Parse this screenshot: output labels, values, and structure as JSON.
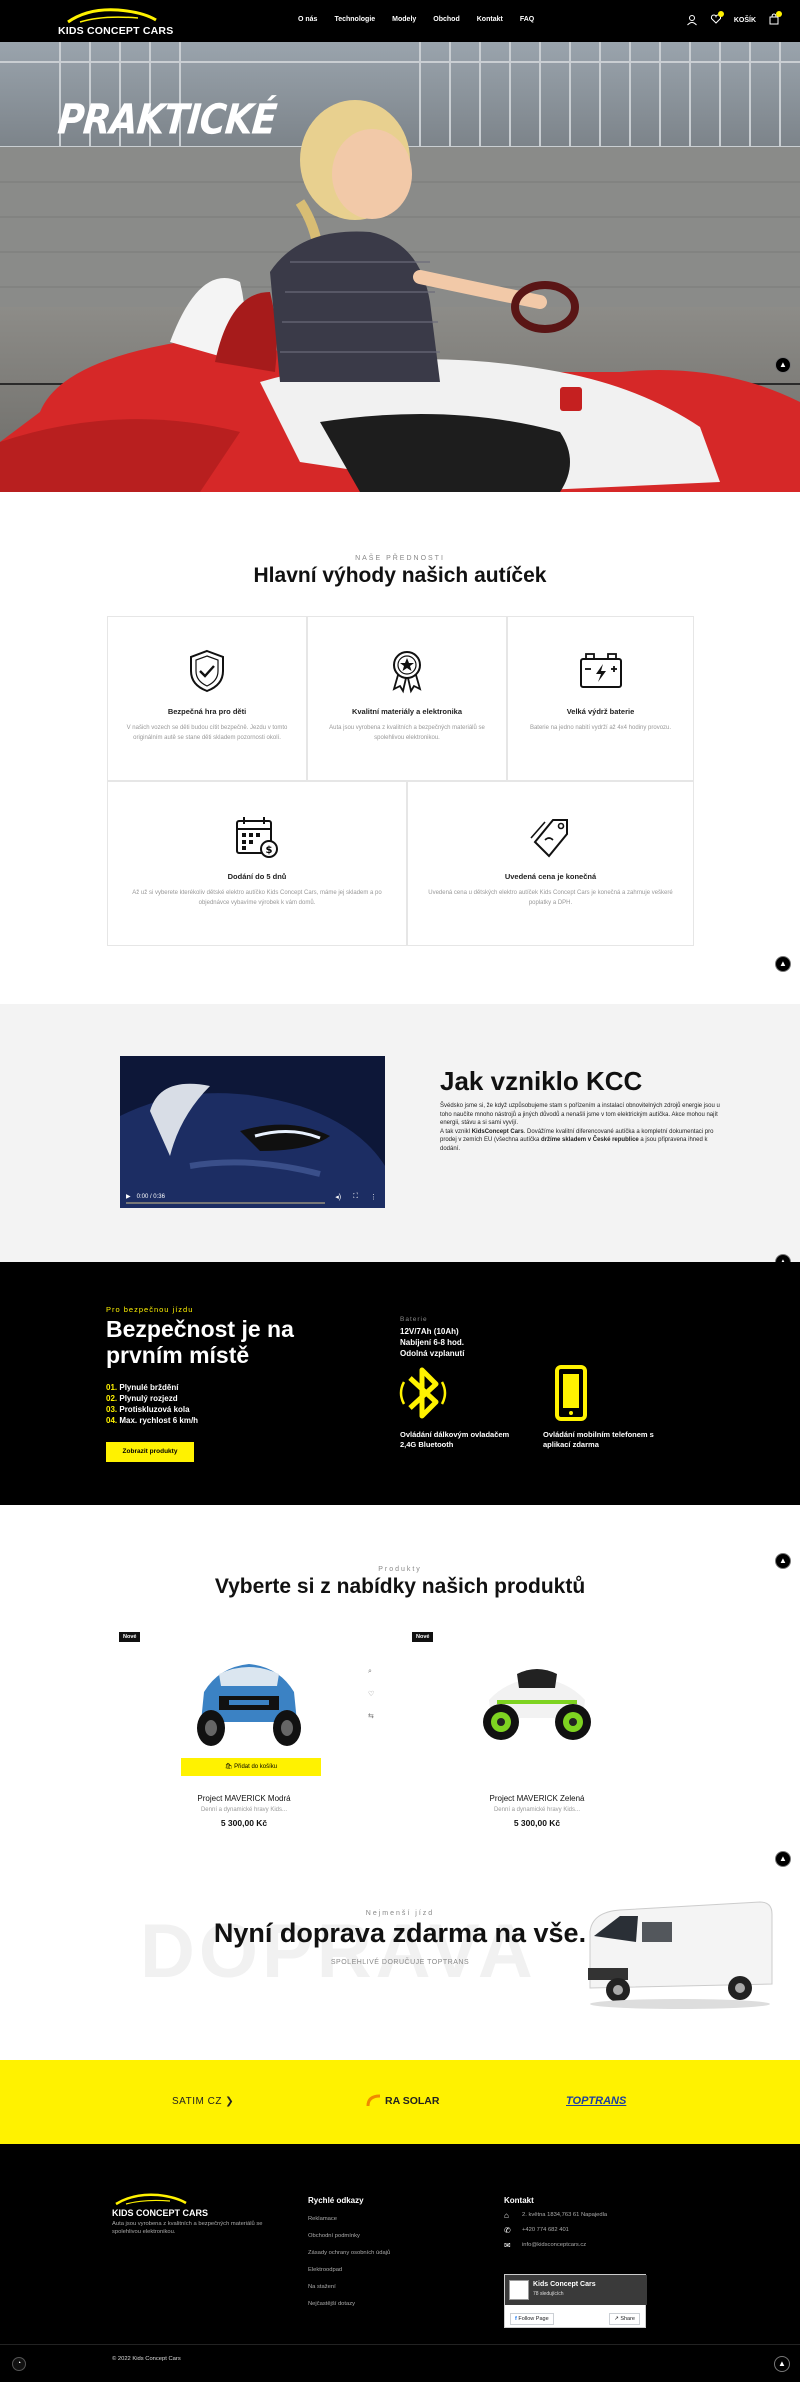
{
  "header": {
    "logo_text": "KIDS CONCEPT CARS",
    "nav": [
      "O nás",
      "Technologie",
      "Modely",
      "Obchod",
      "Kontakt",
      "FAQ"
    ],
    "cart_label": "KOŠÍK",
    "wishlist_count": "0",
    "cart_count": "0"
  },
  "hero": {
    "title": "PRAKTICKÉ"
  },
  "advantages": {
    "overline": "NAŠE PŘEDNOSTI",
    "heading": "Hlavní výhody našich autíček",
    "cards": [
      {
        "icon": "shield-check-icon",
        "title": "Bezpečná hra pro děti",
        "text": "V našich vozech se děti budou cítit bezpečně. Jezdu v tomto originálním autě se stane děti skladem pozornosti okolí."
      },
      {
        "icon": "award-badge-icon",
        "title": "Kvalitní materiály a elektronika",
        "text": "Auta jsou vyrobena z kvalitních a bezpečných materiálů se spolehlivou elektronikou."
      },
      {
        "icon": "battery-icon",
        "title": "Velká výdrž baterie",
        "text": "Baterie na jedno nabití vydrží až 4x4 hodiny provozu."
      },
      {
        "icon": "calendar-icon",
        "title": "Dodání do 5 dnů",
        "text": "Až už si vyberete kterékoliv dětské elektro autíčko Kids Concept Cars, máme jej skladem a po objednávce vybavíme výrobek k vám domů."
      },
      {
        "icon": "price-tag-icon",
        "title": "Uvedená cena je konečná",
        "text": "Uvedená cena u dětských elektro autíček Kids Concept Cars je konečná a zahrnuje veškeré poplatky a DPH."
      }
    ]
  },
  "kcc": {
    "heading": "Jak vzniklo KCC",
    "video_time": "0:00 / 0:36",
    "p1": "Švédsko jsme si, že když uzpůsobujeme stam s pořízením a instalací obnovitelných zdrojů energie jsou u toho naučíte mnoho nástrojů a jiných důvodů a nenašli jsme v tom elektrickým autíčka. Akce mohou najít energii, stávu a si sami vyvíjí.",
    "p2_pre": "A tak vznikl ",
    "p2_brand": "KidsConcept Cars",
    "p2_mid": ". Dovážíme kvalitní diferencované autíčka a kompletní dokumentaci pro prodej v zemích EU (všechna autíčka ",
    "p2_stock": "držíme skladem v České republice",
    "p2_end": " a jsou připravena ihned k dodání."
  },
  "safety": {
    "overline": "Pro bezpečnou jízdu",
    "heading_line1": "Bezpečnost je na",
    "heading_line2": "prvním místě",
    "features": [
      {
        "num": "01.",
        "text": "Plynulé brždění"
      },
      {
        "num": "02.",
        "text": "Plynulý rozjezd"
      },
      {
        "num": "03.",
        "text": "Protiskluzová kola"
      },
      {
        "num": "04.",
        "text": "Max. rychlost 6 km/h"
      }
    ],
    "button": "Zobrazit produkty",
    "battery_label": "Baterie",
    "battery_line1": "12V/7Ah (10Ah)",
    "battery_line2": "Nabíjení 6-8 hod.",
    "battery_line3": "Odolná vzplanutí",
    "bluetooth_line1": "Ovládání dálkovým ovladačem",
    "bluetooth_line2": "2,4G Bluetooth",
    "phone_line1": "Ovládání mobilním telefonem s",
    "phone_line2": "aplikací zdarma"
  },
  "products": {
    "overline": "Produkty",
    "heading": "Vyberte si z nabídky našich produktů",
    "badge": "Nové",
    "add_to_cart": "Přidat do košíku",
    "items": [
      {
        "name": "Project MAVERICK Modrá",
        "desc": "Denní a dynamické hravy Kids...",
        "price": "5 300,00 Kč",
        "color": "#3b82c4"
      },
      {
        "name": "Project MAVERICK Zelená",
        "desc": "Denní a dynamické hravy Kids...",
        "price": "5 300,00 Kč",
        "color": "#7ed321"
      }
    ]
  },
  "shipping": {
    "overline": "Nejmenší jízd",
    "heading": "Nyní doprava zdarma na vše.",
    "sub": "SPOLEHLIVÉ DORUČUJE TOPTRANS",
    "bg_word": "DOPRAVA"
  },
  "partners": [
    "SATIM CZ",
    "RA SOLAR",
    "TOPTRANS"
  ],
  "footer": {
    "brand": "KIDS CONCEPT CARS",
    "about": "Auta jsou vyrobena z kvalitních a bezpečných materiálů se spolehlivou elektronikou.",
    "links_heading": "Rychlé odkazy",
    "links": [
      "Reklamace",
      "Obchodní podmínky",
      "Zásady ochrany osobních údajů",
      "Elektroodpad",
      "Na stažení",
      "Nejčastější dotazy"
    ],
    "contact_heading": "Kontakt",
    "address": "2. května 1834,763 61 Napajedla",
    "phone": "+420 774 682 401",
    "email": "info@kidsconceptcars.cz",
    "fb_name": "Kids Concept Cars",
    "fb_likes": "78 sledujících",
    "fb_follow": "Follow Page",
    "fb_share": "Share",
    "copyright": "© 2022 Kids Concept Cars"
  }
}
